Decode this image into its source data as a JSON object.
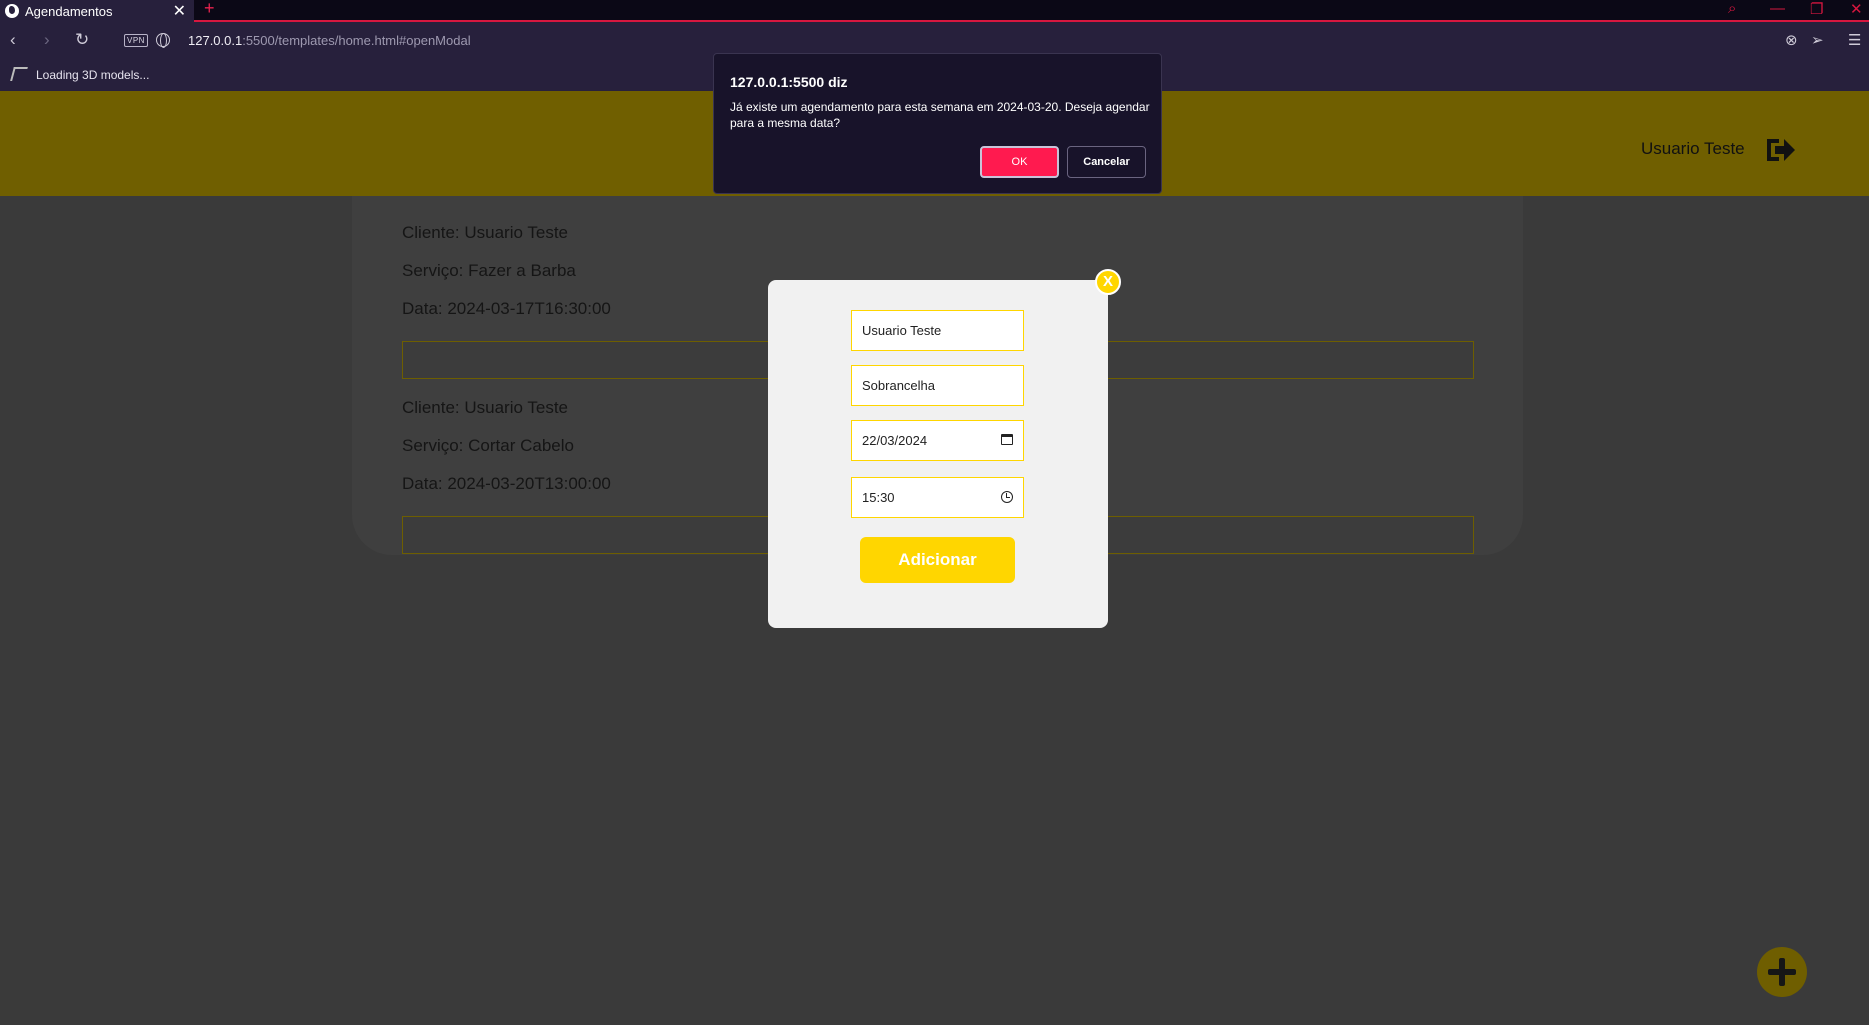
{
  "browser": {
    "tab_title": "Agendamentos",
    "tab_close": "✕",
    "new_tab": "+",
    "vpn_label": "VPN",
    "url_host": "127.0.0.1",
    "url_rest": ":5500/templates/home.html#openModal",
    "bookmark_label": "Loading 3D models..."
  },
  "header": {
    "user_name": "Usuario Teste"
  },
  "appointments": [
    {
      "client": "Cliente: Usuario Teste",
      "service": "Serviço: Fazer a Barba",
      "date": "Data: 2024-03-17T16:30:00"
    },
    {
      "client": "Cliente: Usuario Teste",
      "service": "Serviço: Cortar Cabelo",
      "date": "Data: 2024-03-20T13:00:00"
    }
  ],
  "modal": {
    "close_label": "X",
    "name_value": "Usuario Teste",
    "service_value": "Sobrancelha",
    "date_value": "22/03/2024",
    "time_value": "15:30",
    "submit_label": "Adicionar"
  },
  "dialog": {
    "title": "127.0.0.1:5500 diz",
    "message": "Já existe um agendamento para esta semana em 2024-03-20. Deseja agendar para a mesma data?",
    "ok_label": "OK",
    "cancel_label": "Cancelar"
  },
  "colors": {
    "accent": "#ffd600",
    "dialog_ok": "#ff1a4f",
    "overlay_page": "#3a3a3a"
  }
}
